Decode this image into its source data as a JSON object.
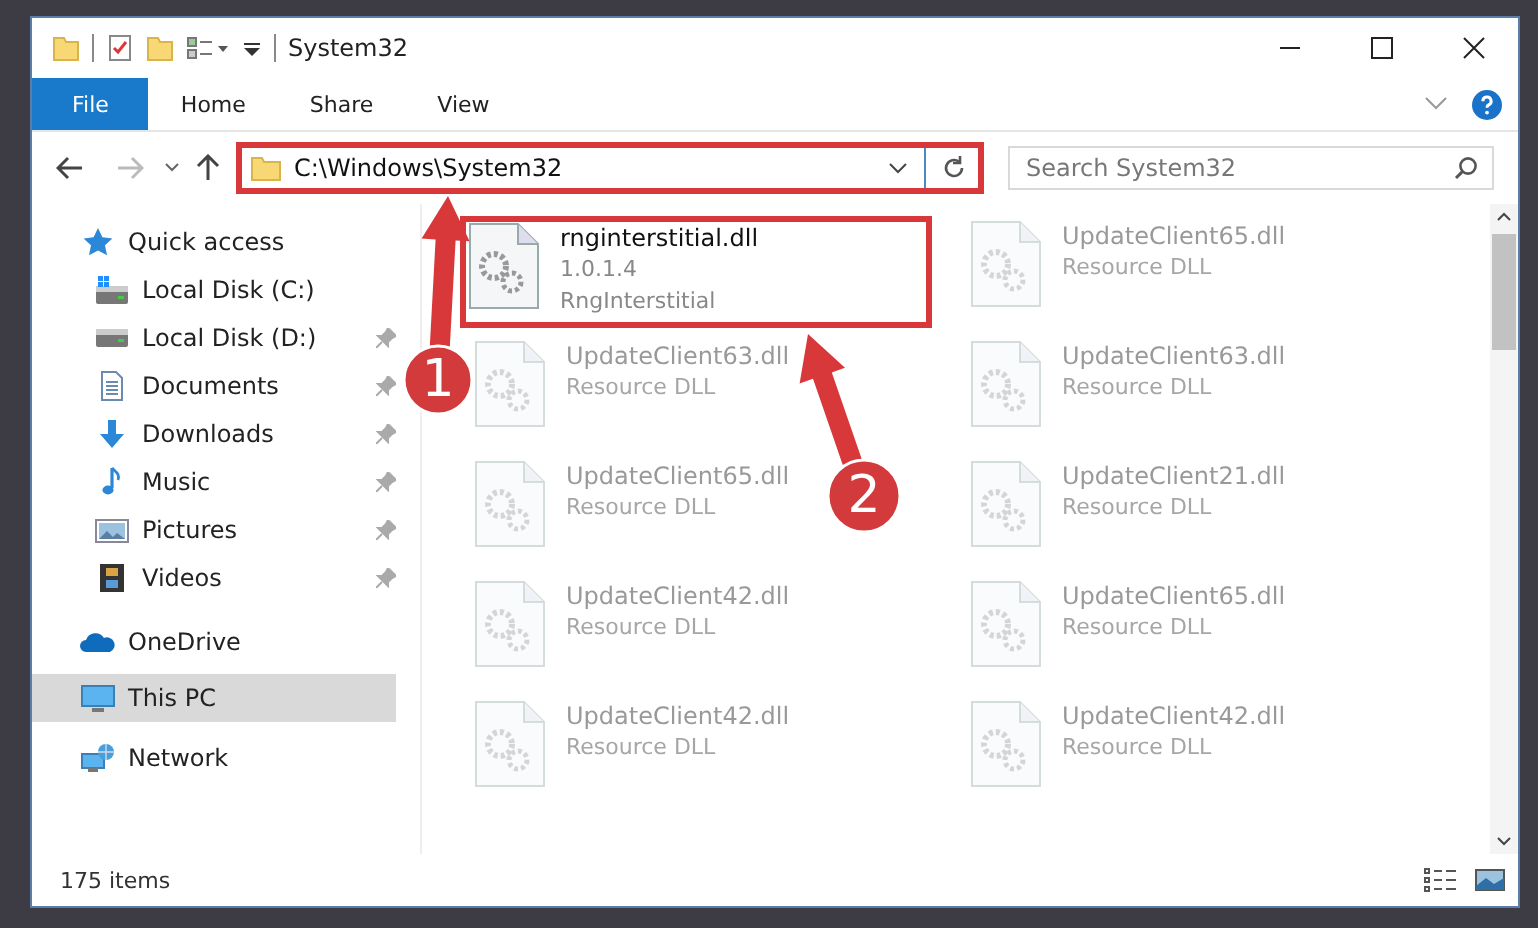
{
  "window": {
    "title": "System32"
  },
  "ribbon_tabs": [
    {
      "label": "File",
      "selected": true
    },
    {
      "label": "Home",
      "selected": false
    },
    {
      "label": "Share",
      "selected": false
    },
    {
      "label": "View",
      "selected": false
    }
  ],
  "address_bar": {
    "path": "C:\\Windows\\System32",
    "highlighted": true
  },
  "search": {
    "placeholder": "Search System32"
  },
  "nav": [
    {
      "label": "Quick access",
      "kind": "star",
      "pinned": false,
      "selected": false,
      "children": [
        {
          "label": "Local Disk (C:)",
          "kind": "drive-c",
          "pinned": false,
          "selected": false
        },
        {
          "label": "Local Disk (D:)",
          "kind": "drive",
          "pinned": true,
          "selected": false
        },
        {
          "label": "Documents",
          "kind": "documents",
          "pinned": true,
          "selected": false
        },
        {
          "label": "Downloads",
          "kind": "downloads",
          "pinned": true,
          "selected": false
        },
        {
          "label": "Music",
          "kind": "music",
          "pinned": true,
          "selected": false
        },
        {
          "label": "Pictures",
          "kind": "pictures",
          "pinned": true,
          "selected": false
        },
        {
          "label": "Videos",
          "kind": "videos",
          "pinned": true,
          "selected": false
        }
      ]
    },
    {
      "label": "OneDrive",
      "kind": "cloud",
      "pinned": false,
      "selected": false
    },
    {
      "label": "This PC",
      "kind": "pc",
      "pinned": false,
      "selected": true
    },
    {
      "label": "Network",
      "kind": "network",
      "pinned": false,
      "selected": false
    }
  ],
  "files": [
    {
      "name": "rnginterstitial.dll",
      "details": [
        "1.0.1.4",
        "RngInterstitial"
      ],
      "dimmed": false,
      "highlighted": true
    },
    {
      "name": "UpdateClient65.dll",
      "details": [
        "Resource DLL"
      ],
      "dimmed": true,
      "highlighted": false
    },
    {
      "name": "UpdateClient63.dll",
      "details": [
        "Resource DLL"
      ],
      "dimmed": true,
      "highlighted": false
    },
    {
      "name": "UpdateClient63.dll",
      "details": [
        "Resource DLL"
      ],
      "dimmed": true,
      "highlighted": false
    },
    {
      "name": "UpdateClient65.dll",
      "details": [
        "Resource DLL"
      ],
      "dimmed": true,
      "highlighted": false
    },
    {
      "name": "UpdateClient21.dll",
      "details": [
        "Resource DLL"
      ],
      "dimmed": true,
      "highlighted": false
    },
    {
      "name": "UpdateClient42.dll",
      "details": [
        "Resource DLL"
      ],
      "dimmed": true,
      "highlighted": false
    },
    {
      "name": "UpdateClient65.dll",
      "details": [
        "Resource DLL"
      ],
      "dimmed": true,
      "highlighted": false
    },
    {
      "name": "UpdateClient42.dll",
      "details": [
        "Resource DLL"
      ],
      "dimmed": true,
      "highlighted": false
    },
    {
      "name": "UpdateClient42.dll",
      "details": [
        "Resource DLL"
      ],
      "dimmed": true,
      "highlighted": false
    }
  ],
  "status_bar": {
    "count": "175 items"
  },
  "callouts": [
    {
      "number": "1"
    },
    {
      "number": "2"
    }
  ]
}
